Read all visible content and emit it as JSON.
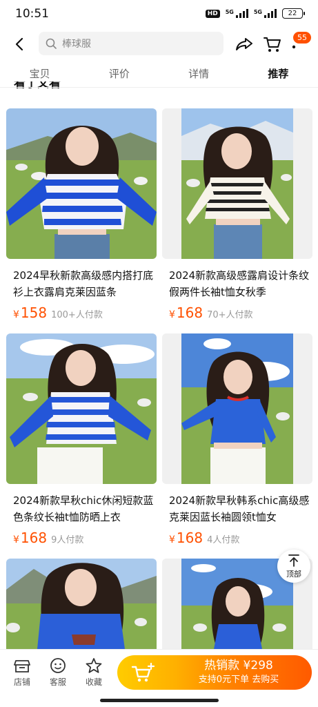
{
  "status": {
    "time": "10:51",
    "hd": "HD",
    "net1": "5G",
    "net2": "5G",
    "battery": "22"
  },
  "header": {
    "search_placeholder": "棒球服",
    "cart_badge": "55"
  },
  "tabs": [
    {
      "label": "宝贝",
      "active": false
    },
    {
      "label": "评价",
      "active": false
    },
    {
      "label": "详情",
      "active": false
    },
    {
      "label": "推荐",
      "active": true
    }
  ],
  "section": {
    "title": "看了又看"
  },
  "products": [
    {
      "title": "2024早秋新款高级感内搭打底衫上衣露肩克莱因蓝条",
      "currency": "¥",
      "price": "158",
      "sold": "100+人付款"
    },
    {
      "title": "2024新款高级感露肩设计条纹假两件长袖t恤女秋季",
      "currency": "¥",
      "price": "168",
      "sold": "70+人付款"
    },
    {
      "title": "2024新款早秋chic休闲短款蓝色条纹长袖t恤防晒上衣",
      "currency": "¥",
      "price": "168",
      "sold": "9人付款"
    },
    {
      "title": "2024新款早秋韩系chic高级感克莱因蓝长袖圆领t恤女",
      "currency": "¥",
      "price": "168",
      "sold": "4人付款"
    }
  ],
  "to_top": {
    "label": "顶部"
  },
  "bottom": {
    "shop": "店铺",
    "service": "客服",
    "favorite": "收藏",
    "buy_line1": "热销款 ¥298",
    "buy_line2": "支持0元下单  去购买"
  },
  "colors": {
    "accent": "#ff5000",
    "blue_top": "#1f4fd6",
    "sky": "#8fb7e8",
    "grass": "#7fa84a"
  }
}
